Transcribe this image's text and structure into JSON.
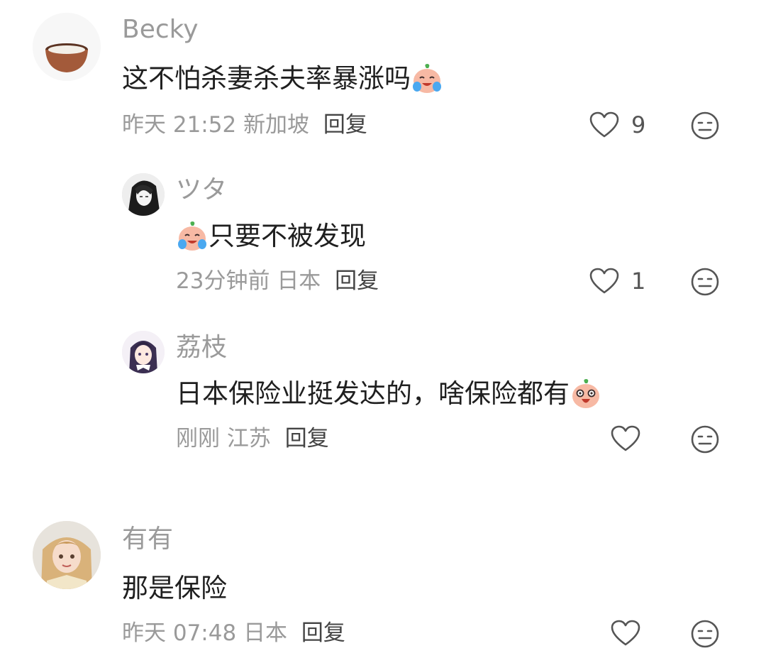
{
  "comments": [
    {
      "username": "Becky",
      "content": "这不怕杀妻杀夫率暴涨吗",
      "emoji": "crying-laugh-peach-emoji",
      "time": "昨天 21:52",
      "location": "新加坡",
      "reply_label": "回复",
      "likes": "9"
    },
    {
      "username": "ツタ",
      "content": "只要不被发现",
      "emoji": "crying-laugh-peach-emoji",
      "time": "23分钟前",
      "location": "日本",
      "reply_label": "回复",
      "likes": "1"
    },
    {
      "username": "荔枝",
      "content": "日本保险业挺发达的，啥保险都有",
      "emoji": "shocked-peach-emoji",
      "time": "刚刚",
      "location": "江苏",
      "reply_label": "回复",
      "likes": ""
    },
    {
      "username": "有有",
      "content": "那是保险",
      "time": "昨天 07:48",
      "location": "日本",
      "reply_label": "回复",
      "likes": ""
    }
  ],
  "icons": {
    "like": "heart-outline-icon",
    "dislike": "meh-face-icon"
  },
  "colors": {
    "username": "#9a9a9a",
    "content": "#1f1f1f",
    "meta": "#9a9a9a",
    "reply": "#444444",
    "icon": "#555555"
  }
}
